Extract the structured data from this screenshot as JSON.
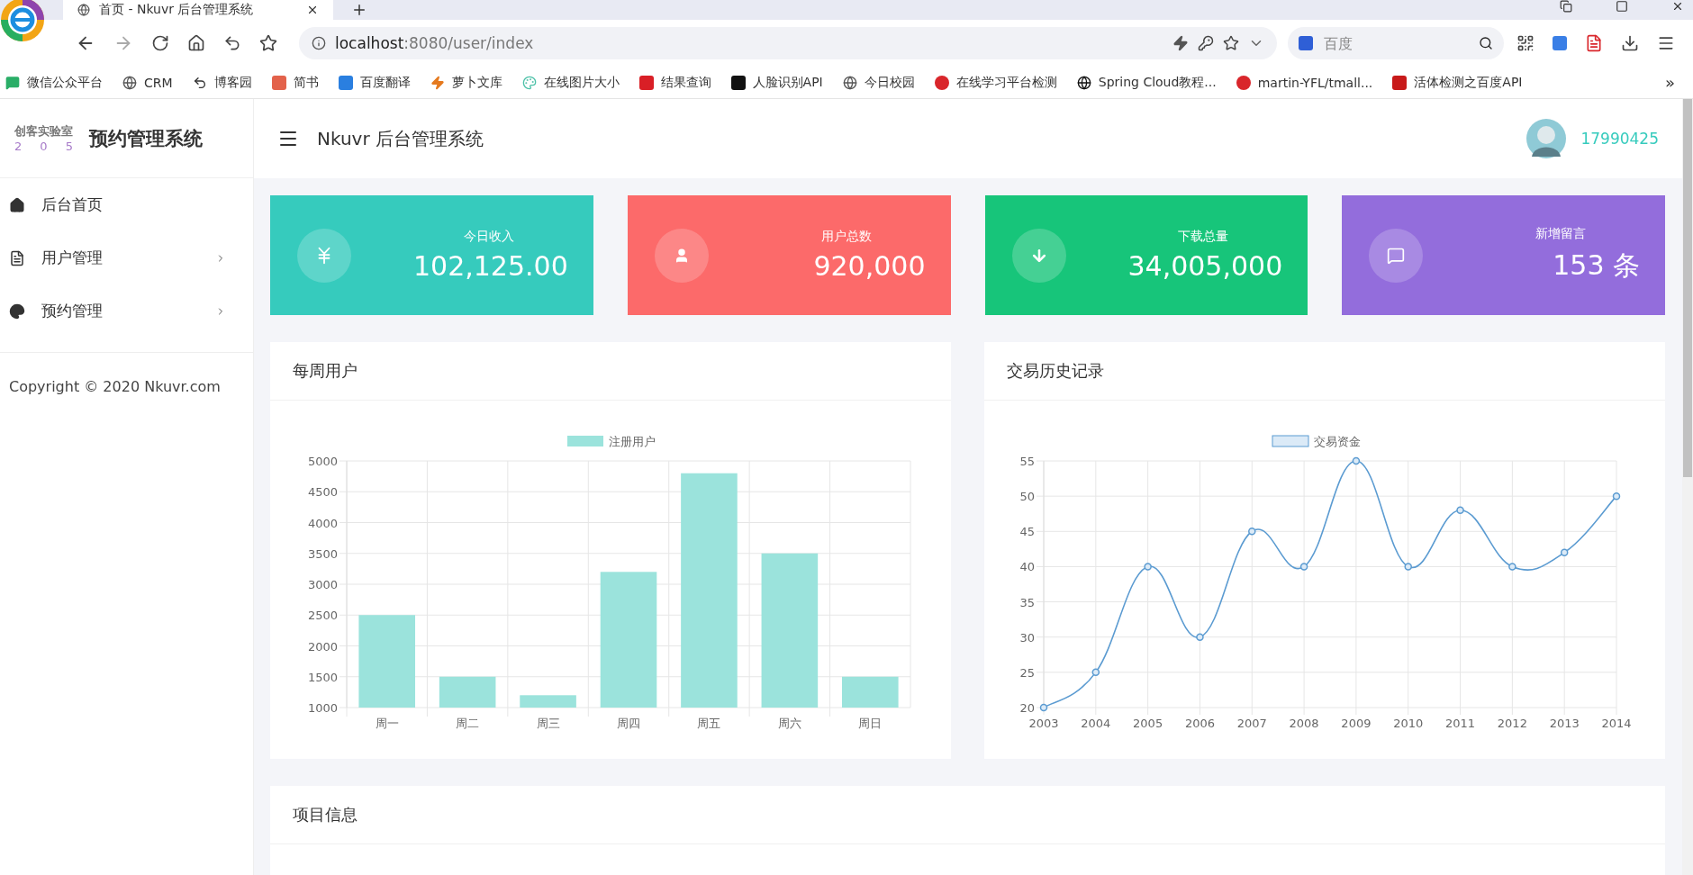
{
  "browser": {
    "tab": {
      "title": "首页 - Nkuvr 后台管理系统"
    },
    "address": {
      "host": "localhost",
      "path": ":8080/user/index"
    },
    "search": {
      "placeholder": "百度"
    },
    "bookmarks": [
      {
        "label": "微信公众平台"
      },
      {
        "label": "CRM"
      },
      {
        "label": "博客园"
      },
      {
        "label": "简书"
      },
      {
        "label": "百度翻译"
      },
      {
        "label": "萝卜文库"
      },
      {
        "label": "在线图片大小"
      },
      {
        "label": "结果查询"
      },
      {
        "label": "人脸识别API"
      },
      {
        "label": "今日校园"
      },
      {
        "label": "在线学习平台检测"
      },
      {
        "label": "Spring Cloud教程..."
      },
      {
        "label": "martin-YFL/tmall..."
      },
      {
        "label": "活体检测之百度API"
      }
    ],
    "more": "»"
  },
  "sidebar": {
    "logo": {
      "name": "创客实验室",
      "digits": [
        "2",
        "0",
        "5"
      ]
    },
    "title": "预约管理系统",
    "items": [
      {
        "label": "后台首页",
        "expandable": false
      },
      {
        "label": "用户管理",
        "expandable": true
      },
      {
        "label": "预约管理",
        "expandable": true
      }
    ],
    "copyright": "Copyright © 2020 Nkuvr.com"
  },
  "header": {
    "title": "Nkuvr 后台管理系统",
    "user": "17990425"
  },
  "stats": [
    {
      "label": "今日收入",
      "value": "102,125.00",
      "color": "#36cbbd"
    },
    {
      "label": "用户总数",
      "value": "920,000",
      "color": "#fc6a6a"
    },
    {
      "label": "下载总量",
      "value": "34,005,000",
      "color": "#17c57a"
    },
    {
      "label": "新增留言",
      "value": "153 条",
      "color": "#936ddc"
    }
  ],
  "panels": [
    {
      "title": "每周用户",
      "chart_data": {
        "type": "bar",
        "categories": [
          "周一",
          "周二",
          "周三",
          "周四",
          "周五",
          "周六",
          "周日"
        ],
        "series": [
          {
            "name": "注册用户",
            "color": "#9be3dc",
            "values": [
              2500,
              1500,
              1200,
              3200,
              4800,
              3500,
              1500
            ]
          }
        ],
        "grid": true,
        "ylim": [
          1000,
          5000
        ],
        "yticks": [
          1000,
          1500,
          2000,
          2500,
          3000,
          3500,
          4000,
          4500,
          5000
        ]
      }
    },
    {
      "title": "交易历史记录",
      "chart_data": {
        "type": "line",
        "categories": [
          "2003",
          "2004",
          "2005",
          "2006",
          "2007",
          "2008",
          "2009",
          "2010",
          "2011",
          "2012",
          "2013",
          "2014"
        ],
        "series": [
          {
            "name": "交易资金",
            "color": "#5b9bd1",
            "marker": true,
            "values": [
              20,
              25,
              40,
              30,
              45,
              40,
              55,
              40,
              48,
              40,
              42,
              50
            ]
          }
        ],
        "grid": true,
        "ylim": [
          20,
          55
        ],
        "yticks": [
          20,
          25,
          30,
          35,
          40,
          45,
          50,
          55
        ]
      }
    }
  ],
  "info_panel": {
    "title": "项目信息"
  }
}
